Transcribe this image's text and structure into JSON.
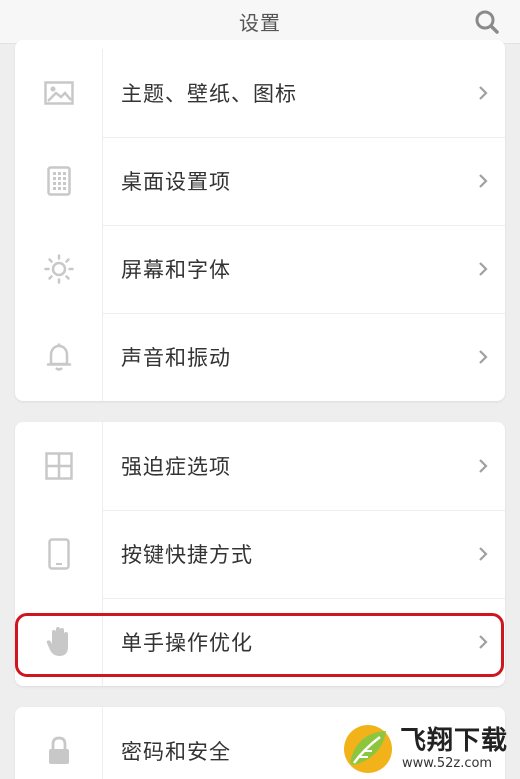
{
  "header": {
    "title": "设置",
    "search_icon": "search-icon"
  },
  "groups": [
    {
      "items": [
        {
          "label": "主题、壁纸、图标",
          "icon": "image-icon"
        },
        {
          "label": "桌面设置项",
          "icon": "grid-icon"
        },
        {
          "label": "屏幕和字体",
          "icon": "brightness-icon"
        },
        {
          "label": "声音和振动",
          "icon": "bell-icon"
        }
      ]
    },
    {
      "items": [
        {
          "label": "强迫症选项",
          "icon": "layout-icon"
        },
        {
          "label": "按键快捷方式",
          "icon": "phone-icon"
        },
        {
          "label": "单手操作优化",
          "icon": "hand-icon",
          "highlighted": true
        }
      ]
    },
    {
      "items": [
        {
          "label": "密码和安全",
          "icon": "lock-icon"
        }
      ]
    }
  ],
  "colors": {
    "background": "#eeeeee",
    "card": "#ffffff",
    "highlight": "#d0151e",
    "icon": "#c8c8c8"
  },
  "watermark": {
    "main": "飞翔下载",
    "sub": "www.52z.com"
  }
}
